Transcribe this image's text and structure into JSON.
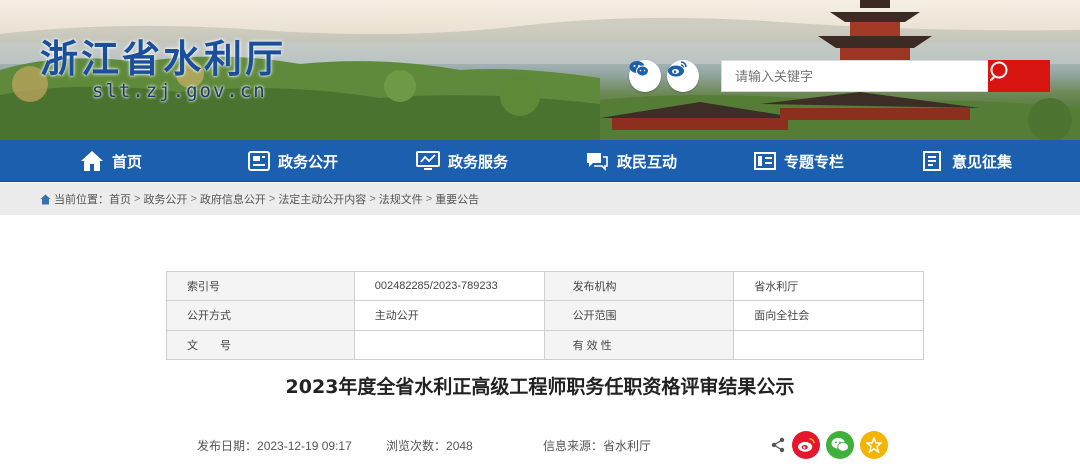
{
  "site": {
    "title": "浙江省水利厅",
    "domain": "slt.zj.gov.cn"
  },
  "header": {
    "social": [
      {
        "icon": "wechat-icon"
      },
      {
        "icon": "weibo-icon"
      }
    ],
    "search": {
      "placeholder": "请输入关键字",
      "button_icon": "search-icon"
    }
  },
  "nav": {
    "items": [
      {
        "label": "首页",
        "icon": "home-icon"
      },
      {
        "label": "政务公开",
        "icon": "gov-open-icon"
      },
      {
        "label": "政务服务",
        "icon": "gov-service-icon"
      },
      {
        "label": "政民互动",
        "icon": "chat-icon"
      },
      {
        "label": "专题专栏",
        "icon": "topic-icon"
      },
      {
        "label": "意见征集",
        "icon": "feedback-icon"
      }
    ]
  },
  "breadcrumb": {
    "prefix": "当前位置：",
    "items": [
      "首页",
      "政务公开",
      "政府信息公开",
      "法定主动公开内容",
      "法规文件",
      "重要公告"
    ],
    "separator": ">"
  },
  "info": {
    "rows": [
      {
        "label1": "索引号",
        "value1": "002482285/2023-789233",
        "label2": "发布机构",
        "value2": "省水利厅"
      },
      {
        "label1": "公开方式",
        "value1": "主动公开",
        "label2": "公开范围",
        "value2": "面向全社会"
      },
      {
        "label1": "文　　号",
        "value1": "",
        "label2": "有 效 性",
        "value2": ""
      }
    ]
  },
  "article": {
    "title": "2023年度全省水利正高级工程师职务任职资格评审结果公示",
    "publish_label": "发布日期：",
    "publish_date": "2023-12-19 09:17",
    "views_label": "浏览次数：",
    "views": "2048",
    "source_label": "信息来源：",
    "source": "省水利厅"
  },
  "share": {
    "icons": [
      "share-icon",
      "weibo-icon",
      "wechat-icon",
      "favorite-icon"
    ]
  },
  "colors": {
    "nav_bg": "#1c5fae",
    "search_btn": "#d7140f",
    "logo": "#1b4f9b",
    "weibo": "#e6162d",
    "wechat": "#3fb13a",
    "favorite": "#f4b400"
  }
}
